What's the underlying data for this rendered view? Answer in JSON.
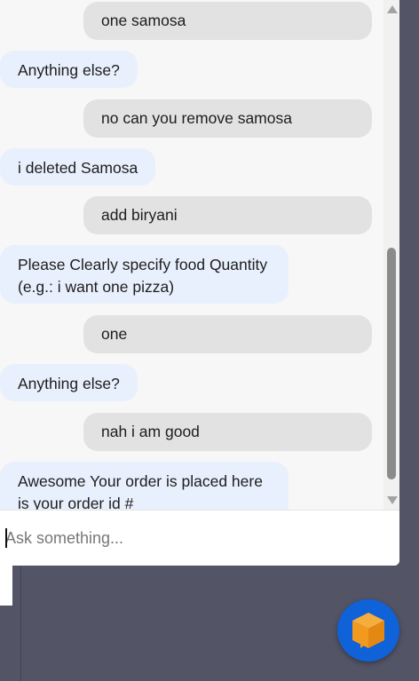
{
  "messages": [
    {
      "role": "user",
      "text": "one samosa"
    },
    {
      "role": "bot",
      "text": "Anything else?"
    },
    {
      "role": "user",
      "text": "no can you remove samosa"
    },
    {
      "role": "bot",
      "text": "i deleted Samosa"
    },
    {
      "role": "user",
      "text": "add biryani"
    },
    {
      "role": "bot",
      "text": "Please Clearly specify food Quantity (e.g.: i want one pizza)"
    },
    {
      "role": "user",
      "text": "one"
    },
    {
      "role": "bot",
      "text": "Anything else?"
    },
    {
      "role": "user",
      "text": "nah i am good"
    },
    {
      "role": "bot",
      "text": "Awesome Your order is placed here is your order id #"
    }
  ],
  "input": {
    "placeholder": "Ask something...",
    "value": ""
  },
  "launcher": {
    "icon": "chat-cube-icon"
  },
  "colors": {
    "user_bubble": "#e1e2e1",
    "bot_bubble": "#e9f0fd",
    "launcher": "#0f62d8",
    "launcher_icon": "#f39a1e",
    "background": "#535466"
  }
}
